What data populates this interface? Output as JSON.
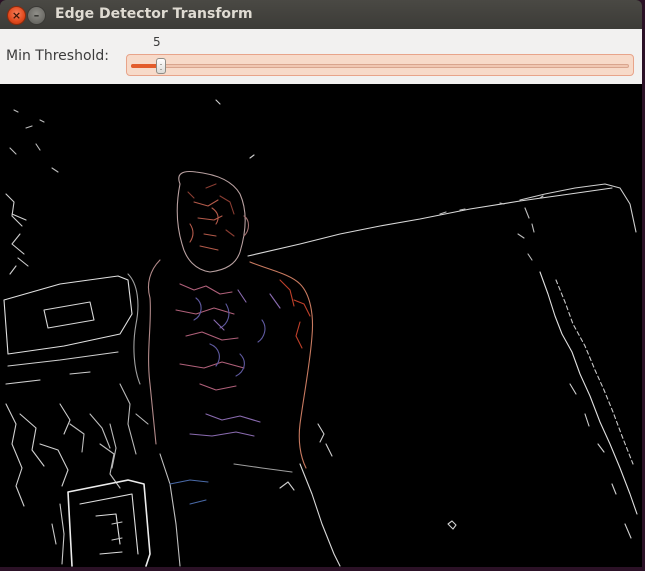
{
  "window": {
    "title": "Edge Detector Transform",
    "close_icon": "close-icon",
    "minimize_icon": "minimize-icon"
  },
  "threshold": {
    "label": "Min Threshold:",
    "value": "5",
    "fraction": 0.06
  },
  "colors": {
    "slider_fill": "#e35c2b",
    "background": "#000000",
    "edge_white": "#e6e6e6",
    "edge_orange": "#c9744b",
    "edge_blue": "#4a6aa8"
  }
}
